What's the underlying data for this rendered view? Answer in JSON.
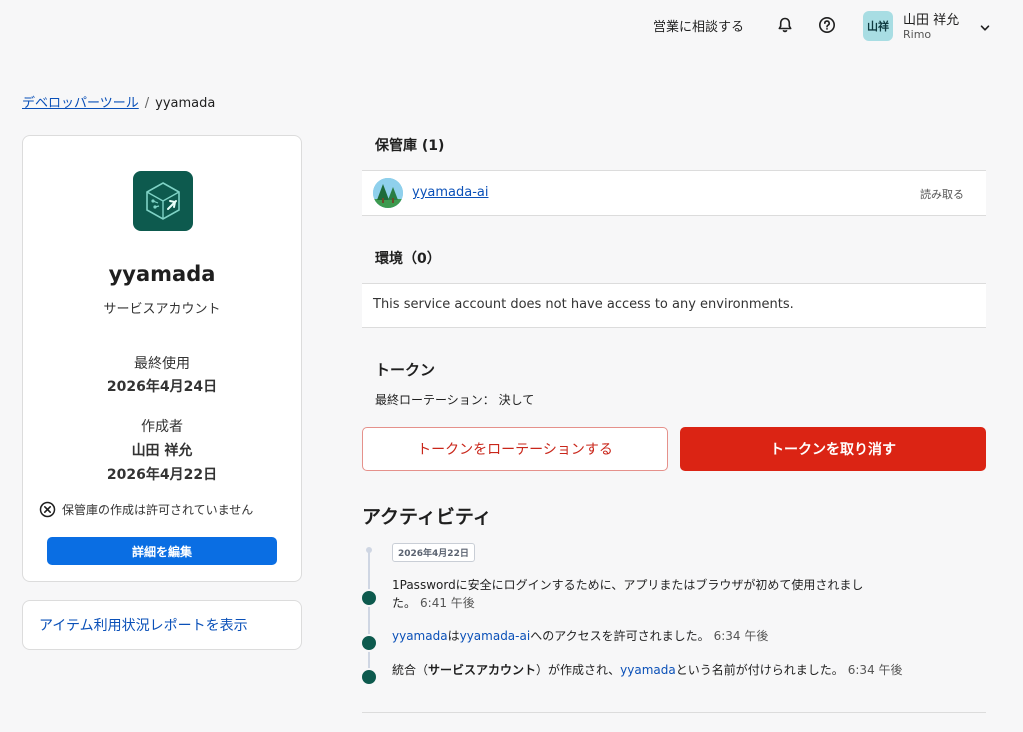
{
  "header": {
    "contact_sales": "営業に相談する",
    "avatar_initials": "山祥",
    "user_name": "山田 祥允",
    "user_org": "Rimo"
  },
  "breadcrumb": {
    "parent": "デベロッパーツール",
    "separator": "/",
    "current": "yyamada"
  },
  "profile": {
    "name": "yyamada",
    "type": "サービスアカウント",
    "last_used_label": "最終使用",
    "last_used_value": "2026年4月24日",
    "created_by_label": "作成者",
    "created_by_name": "山田 祥允",
    "created_date": "2026年4月22日",
    "vault_permission_note": "保管庫の作成は許可されていません",
    "edit_button": "詳細を編集"
  },
  "report_link": "アイテム利用状況レポートを表示",
  "vaults": {
    "title": "保管庫 (1)",
    "items": [
      {
        "name": "yyamada-ai",
        "permission": "読み取る"
      }
    ]
  },
  "environments": {
    "title": "環境（0）",
    "empty_message": "This service account does not have access to any environments."
  },
  "token": {
    "title": "トークン",
    "last_rotation": "最終ローテーション： 決して",
    "rotate_button": "トークンをローテーションする",
    "revoke_button": "トークンを取り消す"
  },
  "activity": {
    "title": "アクティビティ",
    "date_badge": "2026年4月22日",
    "events": [
      {
        "line1": "1Passwordに安全にログインするために、アプリまたはブラウザが初めて使用されまし",
        "line2": "た。",
        "time": "6:41 午後"
      },
      {
        "link1": "yyamada",
        "mid1": "は",
        "link2": "yyamada-ai",
        "rest": "へのアクセスを許可されました。",
        "time": "6:34 午後"
      },
      {
        "pre": "統合（",
        "bold": "サービスアカウント",
        "mid": "）が作成され、",
        "link": "yyamada",
        "rest": "という名前が付けられました。",
        "time": "6:34 午後"
      }
    ]
  },
  "colors": {
    "link": "#0a50b8",
    "primary_button": "#0a6ee3",
    "danger": "#db2414",
    "logo_bg": "#0d5a4e"
  }
}
